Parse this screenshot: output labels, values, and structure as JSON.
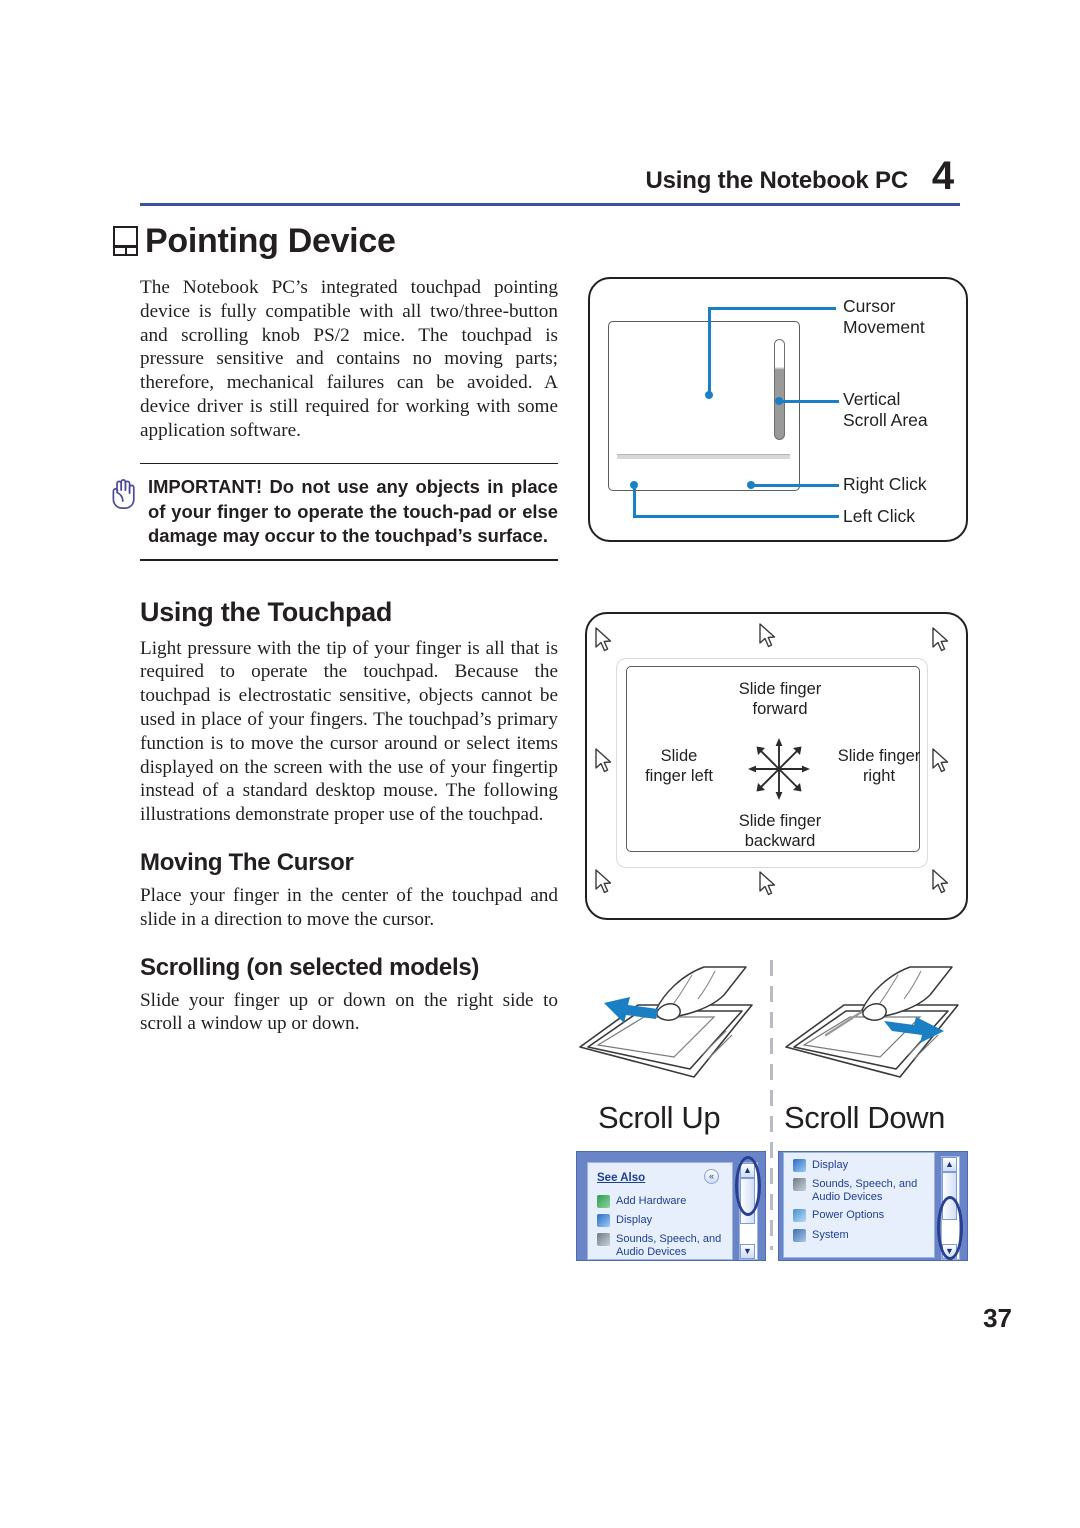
{
  "header": {
    "title": "Using the Notebook PC",
    "chapter": "4",
    "rule_color": "#3b52a8"
  },
  "section": {
    "icon": "touchpad-icon",
    "title": "Pointing Device",
    "intro_paragraph": "The Notebook PC’s integrated touchpad pointing device is fully compatible with all two/three-button and scrolling knob PS/2 mice. The touchpad is pressure sensitive and contains no moving parts; therefore, mechanical failures can be avoided. A device driver is still required for working with some application software."
  },
  "note": {
    "icon": "hand-icon",
    "icon_color": "#4a4a9c",
    "text": "IMPORTANT! Do not use any objects in place of your finger to operate the touch-pad or else damage may occur to the touchpad’s surface."
  },
  "touchpad_section": {
    "heading": "Using the Touchpad",
    "paragraph": "Light pressure with the tip of your finger is all that is required to operate the touchpad. Because the touchpad is electrostatic sensitive, objects cannot be used in place of your fingers. The touchpad’s primary function is to move the cursor around or select items displayed on the screen with the use of your fingertip instead of a standard desktop mouse. The following illustrations demonstrate proper use of the touchpad."
  },
  "moving_cursor": {
    "heading": "Moving The Cursor",
    "paragraph": "Place your finger in the center of the touchpad and slide in a direction to move the cursor."
  },
  "scrolling": {
    "heading": "Scrolling (on selected models)",
    "paragraph": "Slide your finger up or down on the right side to scroll a window up or down."
  },
  "diagram_touchpad_parts": {
    "accent_color": "#1b7fc4",
    "labels": {
      "cursor_movement": "Cursor\nMovement",
      "vertical_scroll_area": "Vertical\nScroll Area",
      "right_click": "Right Click",
      "left_click": "Left Click"
    }
  },
  "diagram_slide_directions": {
    "labels": {
      "forward": "Slide finger\nforward",
      "backward": "Slide finger\nbackward",
      "left": "Slide\nfinger left",
      "right": "Slide finger\nright"
    },
    "arrow_burst_directions": 8
  },
  "diagram_scroll": {
    "scroll_up_caption": "Scroll Up",
    "scroll_down_caption": "Scroll Down",
    "arrow_color": "#1b7fc4",
    "left_panel": {
      "header": "See Also",
      "items": [
        "Add Hardware",
        "Display",
        "Sounds, Speech, and\nAudio Devices"
      ],
      "scroll_up_glyph": "▲",
      "scroll_down_glyph": "▼",
      "collapse_glyph": "«"
    },
    "right_panel": {
      "items": [
        "Display",
        "Sounds, Speech, and\nAudio Devices",
        "Power Options",
        "System"
      ],
      "scroll_up_glyph": "▲",
      "scroll_down_glyph": "▼"
    }
  },
  "footer": {
    "page_number": "37"
  }
}
